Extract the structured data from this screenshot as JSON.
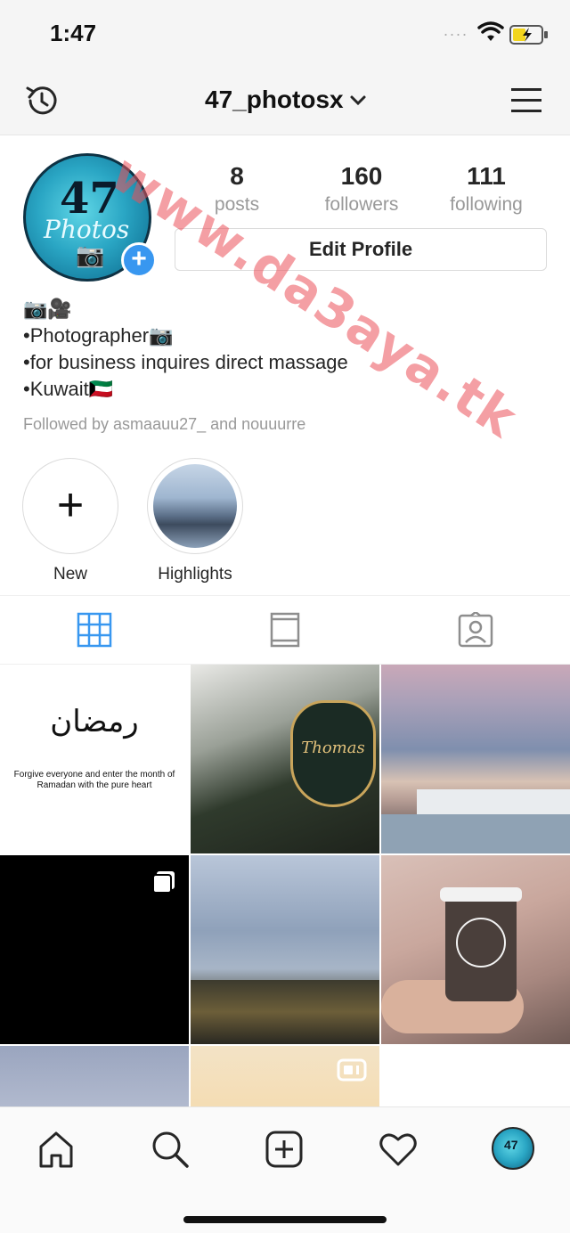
{
  "status_bar": {
    "time": "1:47",
    "signal": "....",
    "icons": [
      "wifi-icon",
      "battery-charging-icon"
    ]
  },
  "header": {
    "username": "47_photosx",
    "icons": [
      "history-icon",
      "chevron-down-icon",
      "menu-icon"
    ]
  },
  "profile": {
    "avatar_text": "47",
    "avatar_subtext": "Photos",
    "add_badge": "+",
    "stats": [
      {
        "value": "8",
        "label": "posts"
      },
      {
        "value": "160",
        "label": "followers"
      },
      {
        "value": "111",
        "label": "following"
      }
    ],
    "edit_button": "Edit Profile",
    "bio": [
      "📷🎥",
      "•Photographer📷",
      "•for business inquires direct massage",
      "•Kuwait🇰🇼"
    ],
    "followed_by": "Followed by asmaauu27_ and nouuurre"
  },
  "highlights": [
    {
      "label": "New",
      "icon": "plus-icon"
    },
    {
      "label": "Highlights",
      "icon": "highlight-cover"
    }
  ],
  "tabs": [
    {
      "name": "grid",
      "icon": "grid-icon",
      "active": true
    },
    {
      "name": "feed",
      "icon": "feed-icon",
      "active": false
    },
    {
      "name": "tagged",
      "icon": "tagged-person-icon",
      "active": false
    }
  ],
  "posts": {
    "p1_arabic": "رمضان",
    "p1_caption": "Forgive everyone and enter the month of Ramadan with the pure heart",
    "p2_sign": "Thomas"
  },
  "bottom_nav": [
    "home-icon",
    "search-icon",
    "add-post-icon",
    "activity-heart-icon",
    "profile-avatar"
  ],
  "watermark": "www.da3aya.tk",
  "colors": {
    "accent": "#3897f0",
    "watermark": "#eb505a",
    "text": "#262626",
    "muted": "#999999"
  }
}
